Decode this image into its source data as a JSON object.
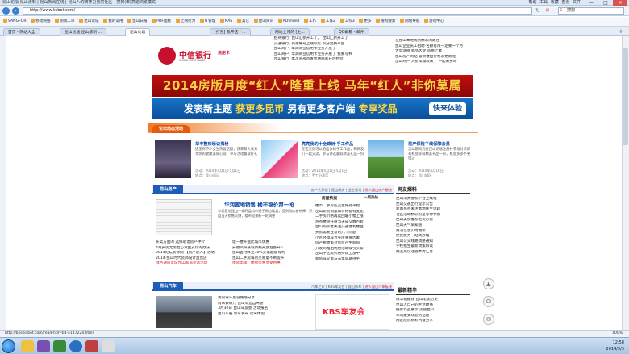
{
  "window": {
    "title": "昆山论坛 昆山法制 | 昆山新闻在线 | 昆山人的精神力量的社区 - 搜狗(IE)高速浏览模式",
    "menu": [
      "帮助",
      "工具",
      "收藏",
      "查看",
      "文件"
    ],
    "controls": [
      "—",
      "□",
      "✕"
    ]
  },
  "addressbar": {
    "url": "http://www.ksbot.com/",
    "search_value": "搜狗",
    "search_placeholder": "搜狗"
  },
  "favorites": [
    "SANGFOR",
    "移动网络",
    "测试工单",
    "昆山论坛",
    "我的常用",
    "昆山日报",
    "PDF图标",
    "上网行为",
    "IT管理",
    "NAS",
    "其它",
    "昆山资讯",
    "ADShield",
    "工作",
    "工作2",
    "工作3",
    "更多",
    "搜狗搜索",
    "网站导航",
    "游戏中心",
    "开发者",
    "文件"
  ],
  "tabs": [
    {
      "label": "首页 - 网站大全",
      "active": false
    },
    {
      "label": "昆山论坛 昆山法制 ...",
      "active": true
    },
    {
      "label": "昆山论坛",
      "active": false
    },
    {
      "label": "[打包] 我开这个...",
      "active": false
    },
    {
      "label": "网站上传的 [主...",
      "active": false
    },
    {
      "label": "QQ邮箱 - 邮件",
      "active": false
    }
  ],
  "top_news": [
    "[招商银行] 昆山汇新开工了， 昆山汇新开工了",
    "[交通银行] 商家帐号上线职信 积分兑换平台",
    "[昆山商户] 华润商业信用卡业务开展了",
    "[昆山商户] 华润商业信用卡业务开展了 我要写书",
    "[昆山银行] 本次总部首发优惠商家开启特价"
  ],
  "right_links": [
    "在昆山本地找到精彩的路径",
    "昆山企业员工招聘·名额有限一定要一个月",
    "大型促销 新品大促 品质上乘",
    "昆山房产网站 最新楼盘价格表更新啦",
    "昆山商户 大折扣爆款来了 一起来买呀"
  ],
  "citic": {
    "name": "中信银行",
    "en": "CHINA CITIC BANK",
    "card": "信用卡"
  },
  "banner1": "2014房版月度“红人”隆重上线 马年“红人”非你莫属",
  "banner2": {
    "pre": "发表新主题",
    "hl1": "获更多昆币",
    "mid": " 另有更多客户端",
    "hl2": "专享奖品",
    "btn": "快来体验"
  },
  "section_tab": "论坛动态活动",
  "features": [
    {
      "title": "华丰整形秘诀揭秘",
      "desc": "这里有不少女生热议话题，快来和大家分享你的健康美丽心得，参与活动赢取好礼",
      "date": "活动：2014年4月1日-5月1日",
      "loc": "地点：昆山论坛"
    },
    {
      "title": "亮亮我的十全锦树·手工作品",
      "desc": "在这里你可以晒出你的手工作品，和网友们一起交流，参与评选赢取精美礼品一份",
      "date": "活动：2014年4月1日-5月1日",
      "loc": "地点：手工分享区"
    },
    {
      "title": "昆产保险下线保障会员",
      "desc": "活动期间凡在昆山论坛注册并参与讨论即有机会获得精美礼品一份，机会多多不要错过",
      "date": "活动：2014年4月18日",
      "loc": "地点：昆山城区"
    }
  ],
  "property": {
    "label": "昆山房产",
    "more_links": [
      "房产大家谈",
      "昆山新房",
      "业主论坛"
    ],
    "more_red": "进入昆山房产板块",
    "headline": "华润置地销售 楼市稳价第一枪",
    "summary": "华润置地昆山一期开盘均价低于周边楼盘，受到购房者热捧，开盘当天销售火爆，楼市迎来新一轮调整",
    "list_left": [
      "买卖方面的 选择靠谱房产中介",
      "4月买房无需担心资金支付的办法",
      "2014论坛装修网 【房产达人】活动",
      "2014·昆山时代装饰设计直营店",
      "绿色通道论坛昆山家居装饰活动"
    ],
    "list_right": [
      "理一楼开盘比城市优惠",
      "安徽凤阳县城新规开放准备开工",
      "昆山首付降至30%买家超级有利",
      "昆山二手房每月交易量不断提升",
      "加装电梯：楼盘优惠享受特惠"
    ],
    "mid_header": "房屋快报",
    "mid_tag": "一周热帖",
    "mid_list": [
      "楼市二手房成交量保持平稳",
      "昆山新房销量和价格都有变化",
      "二手房价格再度回暖小幅上涨",
      "热点楼盘开盘当天成交数百套",
      "昆山购房者关注交通便利楼盘",
      "买房需要注意的几个问题",
      "小区环境成为买房重要因素",
      "房产税政策对房价产生影响",
      "开发商推出优惠活动吸引买家",
      "昆山学区房价格持续上涨中",
      "新房成交量与去年同期持平"
    ]
  },
  "car": {
    "label": "昆山汽车",
    "more_links": [
      "汽车之家",
      "KBS车友会",
      "昆山新车"
    ],
    "more_red": "进入昆山汽车板块",
    "list": [
      "我的驾车旅游路线分享",
      "周末去哪儿 昆山周边自驾游",
      "3月30日 昆山车友会 活动报名",
      "昆山车展 新车发布 试驾体验"
    ],
    "ad_text": "KBS车友会"
  },
  "right_col": {
    "header1": "网友爆料",
    "list1": [
      "昆山消费维权平台上线啦",
      "昆山交通出行提示公告",
      "新闻热点关注本地民生话题",
      "社区活动精彩纷呈等你参加",
      "昆山美食推荐吃货必看",
      "昆山天气早知道",
      "路况信息实时更新",
      "便民服务一站式办理",
      "昆山公交线路调整通知",
      "学校招生最新政策解读",
      "网友热议话题本周汇总"
    ],
    "header2": "最新精华",
    "list2": [
      "精华帖推荐 昆山老街历史",
      "昆山人自己的生活故事",
      "摄影作品展示 美丽昆山",
      "本周最受欢迎的话题",
      "网友原创精彩内容分享"
    ]
  },
  "status_text": "http://bbs.ksbot.com/read-htm-tid-4147224.html",
  "zoom": "100%",
  "clock": {
    "time": "12:58",
    "date": "2014/5/3"
  }
}
